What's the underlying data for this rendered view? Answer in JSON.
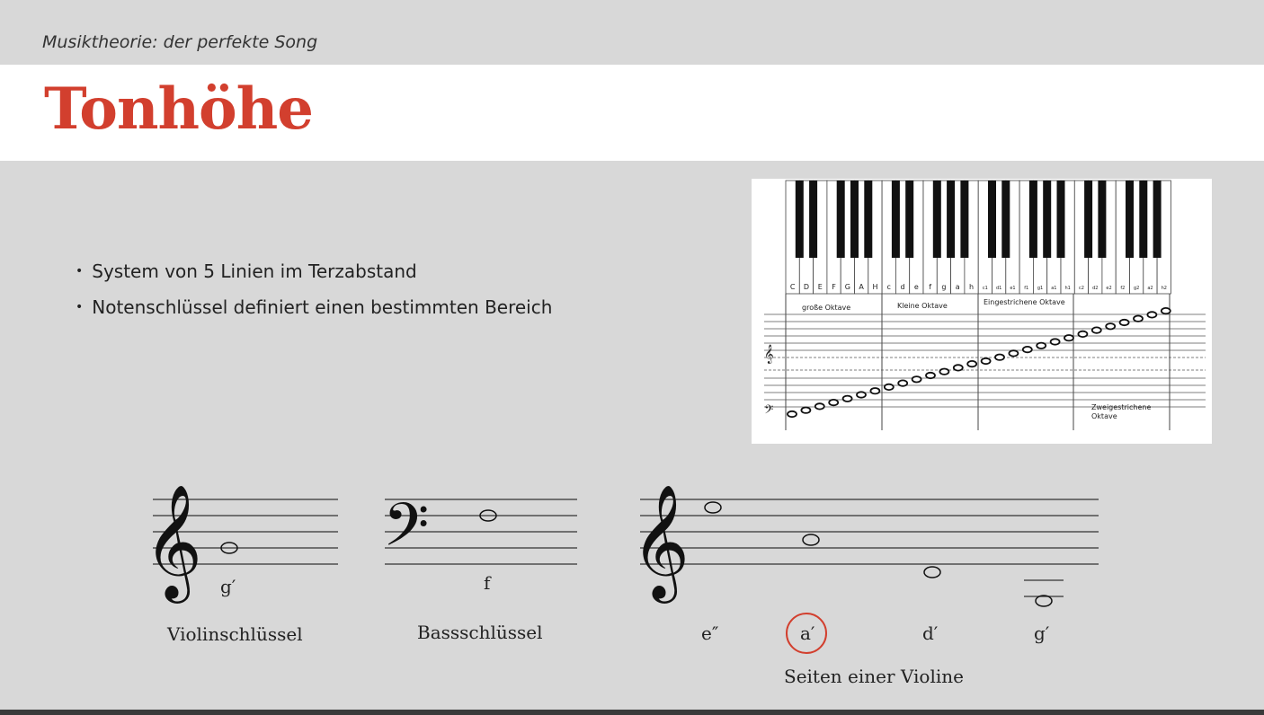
{
  "header": {
    "subtitle": "Musiktheorie: der perfekte Song",
    "title": "Tonhöhe"
  },
  "bullets": [
    "System von 5 Linien im Terzabstand",
    "Notenschlüssel definiert einen bestimmten Bereich"
  ],
  "piano_figure": {
    "key_labels": [
      "C",
      "D",
      "E",
      "F",
      "G",
      "A",
      "H",
      "c",
      "d",
      "e",
      "f",
      "g",
      "a",
      "h",
      "c1",
      "d1",
      "e1",
      "f1",
      "g1",
      "a1",
      "h1",
      "c2",
      "d2",
      "e2",
      "f2",
      "g2",
      "a2",
      "h2"
    ],
    "octaves": [
      "große Oktave",
      "Kleine Oktave",
      "Eingestrichene Oktave"
    ],
    "octave_last_line1": "Zweigestrichene",
    "octave_last_line2": "Oktave"
  },
  "examples": {
    "treble_note_label": "g′",
    "treble_caption": "Violinschlüssel",
    "bass_note_label": "f",
    "bass_caption": "Bassschlüssel",
    "violin_strings": [
      "e″",
      "a′",
      "d′",
      "g′"
    ],
    "violin_caption": "Seiten einer Violine",
    "highlight_color": "#d23f2e"
  }
}
